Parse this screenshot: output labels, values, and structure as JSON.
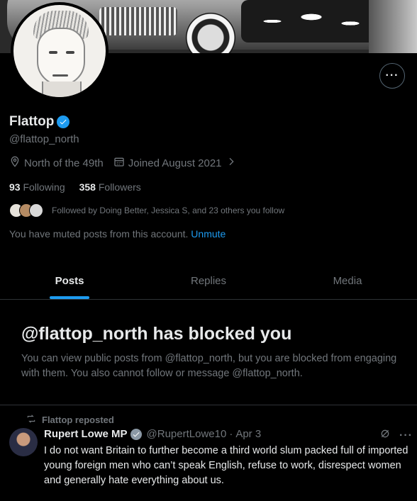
{
  "profile": {
    "name": "Flattop",
    "handle": "@flattop_north",
    "location": "North of the 49th",
    "joined": "Joined August 2021",
    "following_count": "93",
    "following_label": "Following",
    "followers_count": "358",
    "followers_label": "Followers",
    "followed_by": "Followed by Doing Better, Jessica S, and 23 others you follow",
    "muted_text": "You have muted posts from this account.",
    "unmute_label": "Unmute"
  },
  "tabs": [
    "Posts",
    "Replies",
    "Media"
  ],
  "blocked": {
    "title": "@flattop_north has blocked you",
    "body": "You can view public posts from @flattop_north, but you are blocked from engaging with them. You also cannot follow or message @flattop_north."
  },
  "post": {
    "repost_label": "Flattop reposted",
    "author": "Rupert Lowe MP",
    "handle": "@RupertLowe10",
    "separator": "·",
    "date": "Apr 3",
    "text": "I do not want Britain to further become a third world slum packed full of imported young foreign men who can’t speak English, refuse to work, disrespect women and generally hate everything about us."
  },
  "colors": {
    "background": "#000000",
    "primary_text": "#e7e9ea",
    "secondary_text": "#71767b",
    "accent": "#1d9bf0",
    "border": "#2f3336"
  },
  "icons": {
    "more": "more-horizontal-icon",
    "verified": "verified-badge-icon",
    "location": "location-pin-icon",
    "calendar": "calendar-icon",
    "repost": "repost-icon",
    "grok": "grok-icon"
  }
}
